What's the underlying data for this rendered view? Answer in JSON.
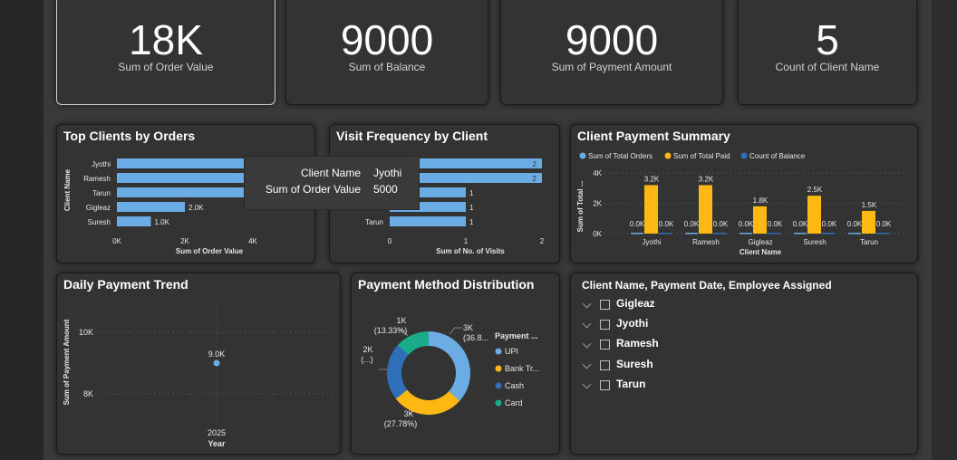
{
  "kpis": [
    {
      "value": "18K",
      "label": "Sum of Order Value"
    },
    {
      "value": "9000",
      "label": "Sum of Balance"
    },
    {
      "value": "9000",
      "label": "Sum of Payment Amount"
    },
    {
      "value": "5",
      "label": "Count of Client Name"
    }
  ],
  "top_clients": {
    "title": "Top Clients by Orders",
    "ylabel": "Client Name",
    "xlabel": "Sum of Order Value",
    "xticks": [
      "0K",
      "2K",
      "4K"
    ],
    "data_labels": [
      "",
      "",
      "",
      "2.0K",
      "1.0K"
    ]
  },
  "visit_freq": {
    "title": "Visit Frequency by Client",
    "xlabel": "Sum of No. of Visits",
    "xticks": [
      "0",
      "1",
      "2"
    ],
    "visible_categories": [
      "",
      "",
      "",
      "",
      "Tarun"
    ],
    "data_labels": [
      "2",
      "2",
      "1",
      "1",
      "1"
    ]
  },
  "tooltip": {
    "k1": "Client Name",
    "v1": "Jyothi",
    "k2": "Sum of Order Value",
    "v2": "5000"
  },
  "payment_summary": {
    "title": "Client Payment Summary",
    "legend": [
      "Sum of Total Orders",
      "Sum of Total Paid",
      "Count of Balance"
    ],
    "ylabel": "Sum of Total ...",
    "xlabel": "Client Name",
    "yticks": [
      "4K",
      "2K",
      "0K"
    ],
    "side_labels_left": [
      "0.0K",
      "0.0K",
      "0.0K",
      "0.0K",
      "0.0K"
    ],
    "side_labels_right": [
      "0.0K",
      "0.0K",
      "0.0K",
      "0.0K",
      "0.0K"
    ],
    "paid_labels": [
      "3.2K",
      "3.2K",
      "1.8K",
      "2.5K",
      "1.5K"
    ]
  },
  "daily_trend": {
    "title": "Daily Payment Trend",
    "ylabel": "Sum of Payment Amount",
    "yticks": [
      "10K",
      "8K"
    ],
    "xtick": "2025",
    "xlabel": "Year",
    "point_label": "9.0K"
  },
  "payment_method": {
    "title": "Payment Method Distribution",
    "legend_title": "Payment ...",
    "legend": [
      "UPI",
      "Bank Tr...",
      "Cash",
      "Card"
    ],
    "labels": {
      "upi_a": "3K",
      "upi_b": "(36.8...",
      "bank_a": "3K",
      "bank_b": "(27.78%)",
      "cash_a": "2K",
      "cash_b": "(...)",
      "card_a": "1K",
      "card_b": "(13.33%)"
    }
  },
  "slicer": {
    "title": "Client Name, Payment Date, Employee Assigned",
    "items": [
      "Gigleaz",
      "Jyothi",
      "Ramesh",
      "Suresh",
      "Tarun"
    ]
  },
  "chart_data": [
    {
      "type": "bar",
      "orientation": "horizontal",
      "title": "Top Clients by Orders",
      "categories": [
        "Jyothi",
        "Ramesh",
        "Tarun",
        "Gigleaz",
        "Suresh"
      ],
      "values": [
        5000,
        5000,
        5000,
        2000,
        1000
      ],
      "xlabel": "Sum of Order Value",
      "ylabel": "Client Name",
      "xlim": [
        0,
        5000
      ],
      "color": "#6cace4"
    },
    {
      "type": "bar",
      "orientation": "horizontal",
      "title": "Visit Frequency by Client",
      "categories": [
        "",
        "",
        "",
        "",
        "Tarun"
      ],
      "values": [
        2,
        2,
        1,
        1,
        1
      ],
      "xlabel": "Sum of No. of Visits",
      "xlim": [
        0,
        2
      ],
      "color": "#6cace4"
    },
    {
      "type": "bar",
      "title": "Client Payment Summary",
      "categories": [
        "Jyothi",
        "Ramesh",
        "Gigleaz",
        "Suresh",
        "Tarun"
      ],
      "series": [
        {
          "name": "Sum of Total Orders",
          "values": [
            0,
            0,
            0,
            0,
            0
          ],
          "color": "#6cace4"
        },
        {
          "name": "Sum of Total Paid",
          "values": [
            3200,
            3200,
            1800,
            2500,
            1500
          ],
          "color": "#fdb813"
        },
        {
          "name": "Count of Balance",
          "values": [
            0,
            0,
            0,
            0,
            0
          ],
          "color": "#2e6fb7"
        }
      ],
      "xlabel": "Client Name",
      "ylabel": "Sum of Total ...",
      "ylim": [
        0,
        4000
      ],
      "legend": "top-left"
    },
    {
      "type": "scatter",
      "title": "Daily Payment Trend",
      "x": [
        2025
      ],
      "y": [
        9000
      ],
      "xlabel": "Year",
      "ylabel": "Sum of Payment Amount",
      "ylim": [
        7500,
        11000
      ],
      "color": "#6cace4"
    },
    {
      "type": "pie",
      "donut": true,
      "title": "Payment Method Distribution",
      "categories": [
        "UPI",
        "Bank Tr...",
        "Cash",
        "Card"
      ],
      "values": [
        3300,
        2500,
        2000,
        1200
      ],
      "colors": [
        "#6cace4",
        "#fdb813",
        "#2e6fb7",
        "#1aab8a"
      ],
      "legend": "right"
    }
  ]
}
